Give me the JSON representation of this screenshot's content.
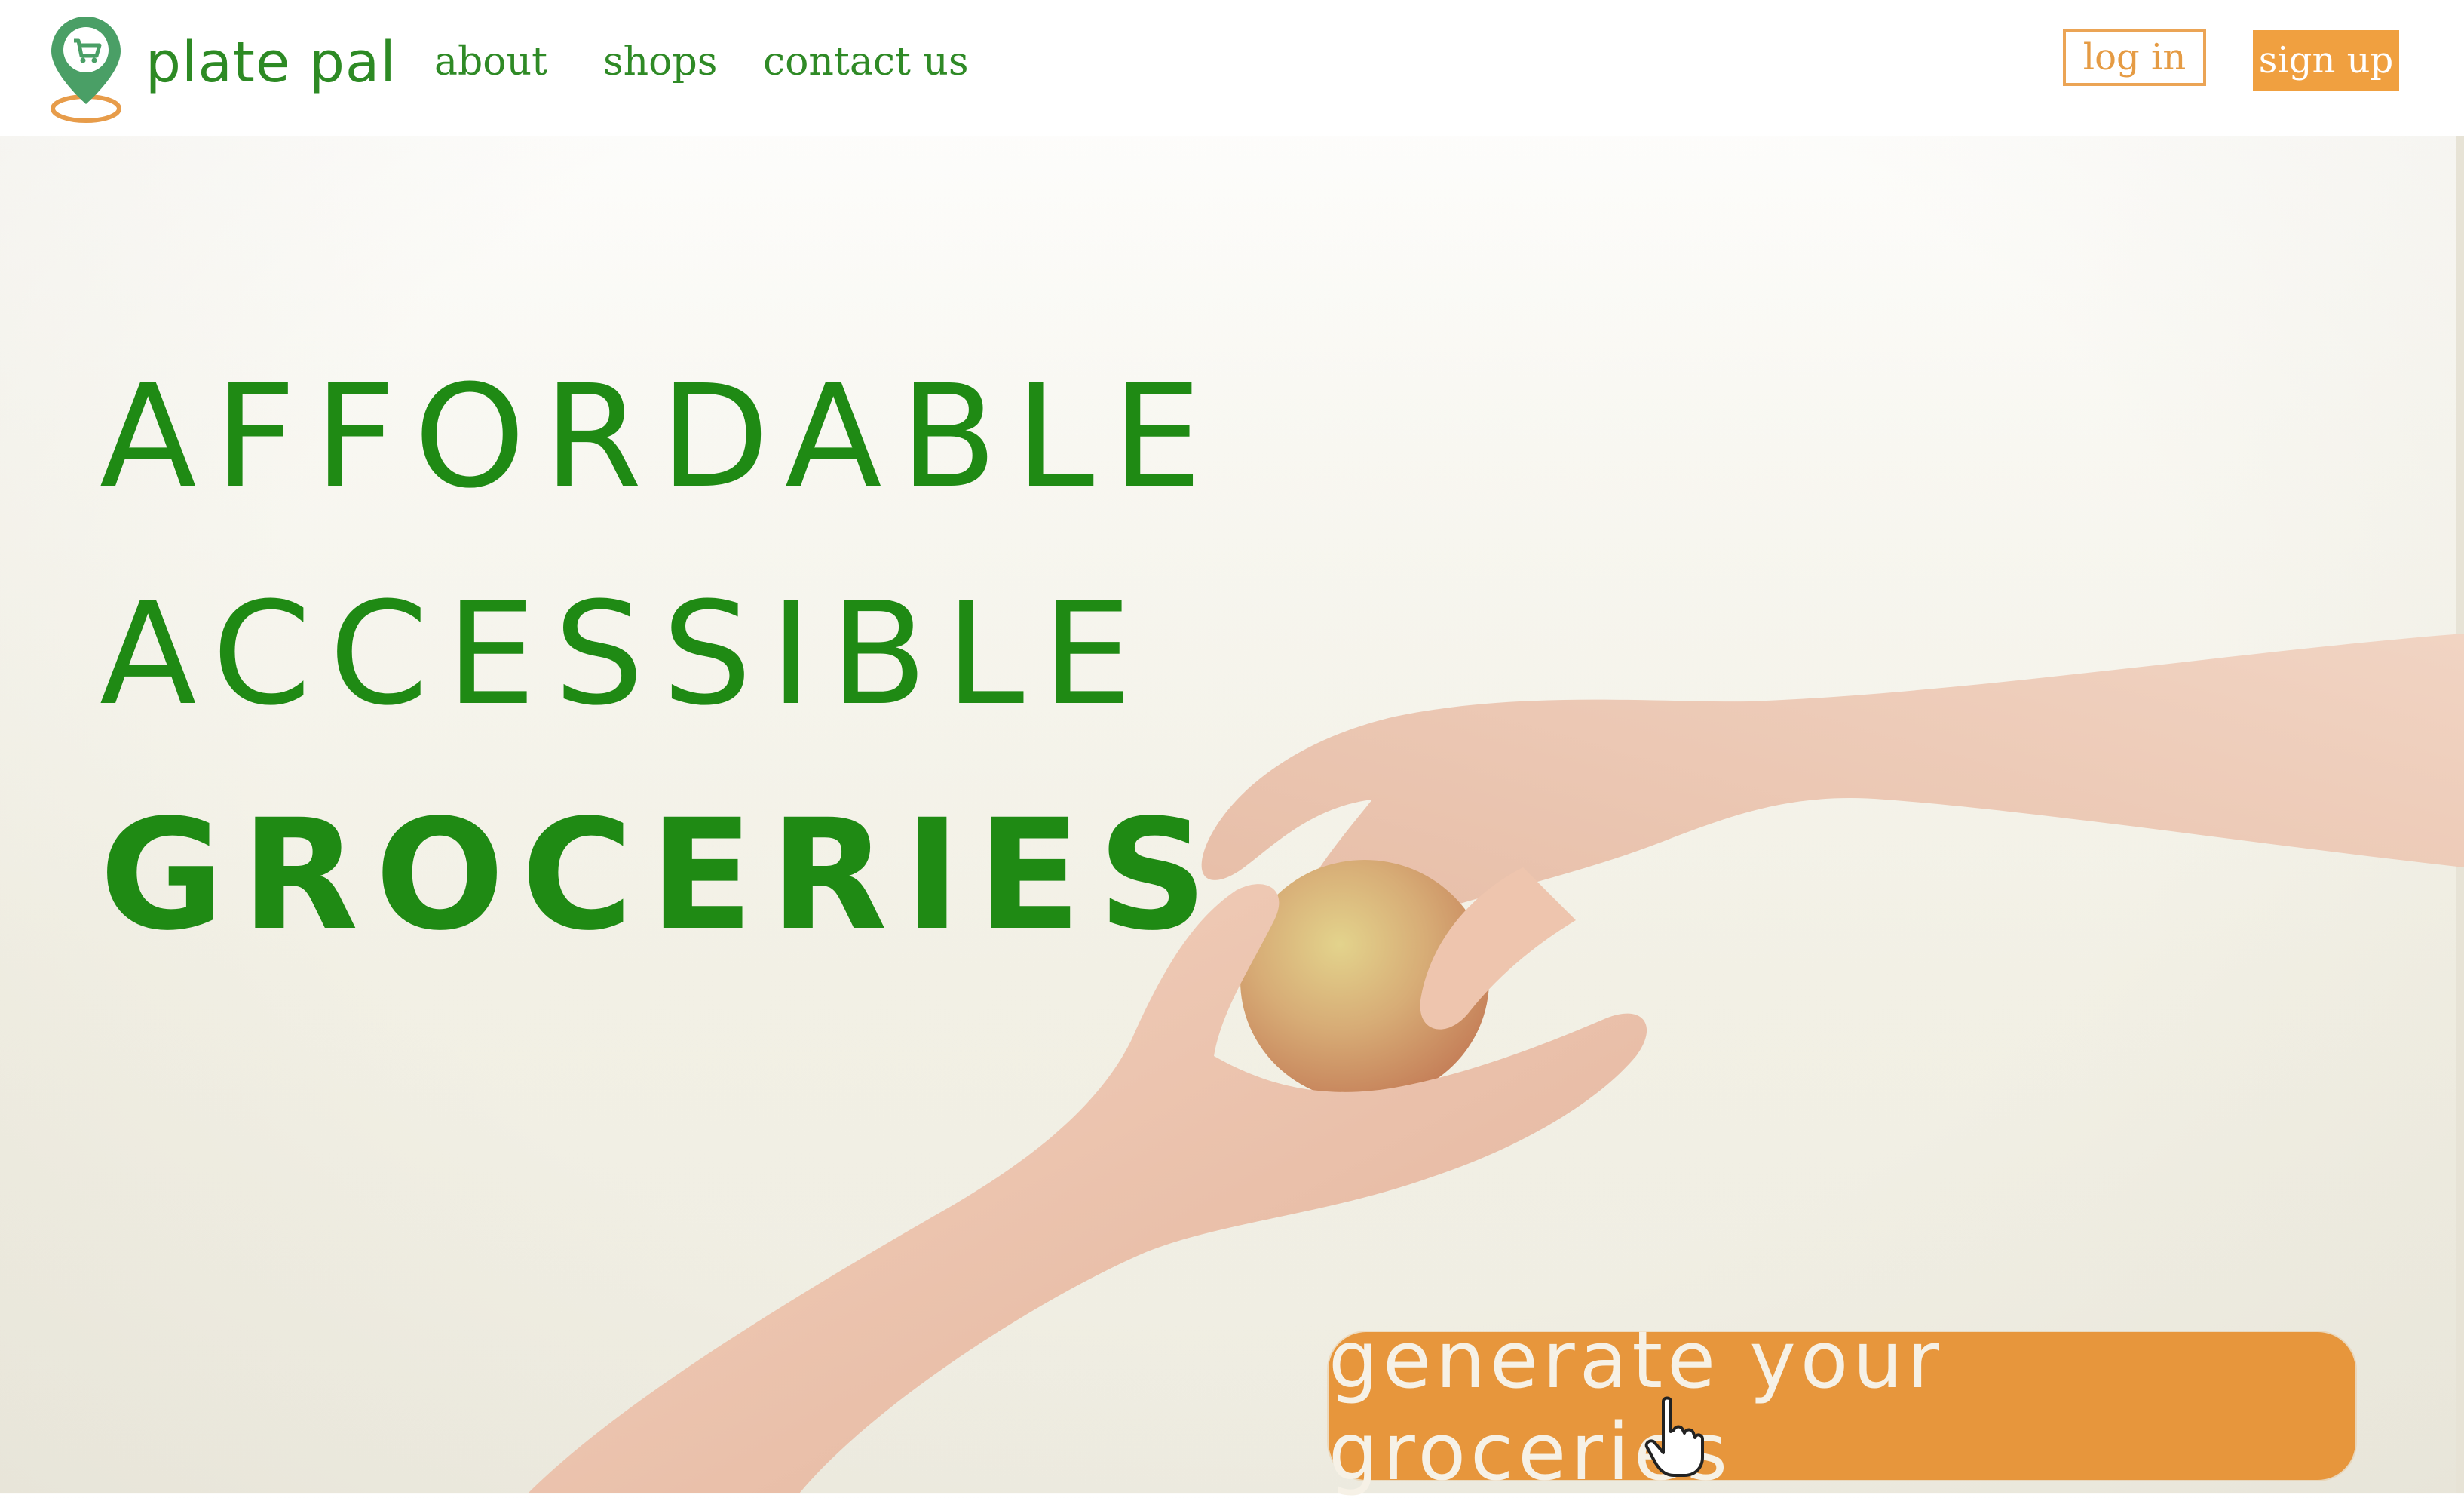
{
  "header": {
    "brand": "plate pal",
    "nav": [
      {
        "label": "about"
      },
      {
        "label": "shops"
      },
      {
        "label": "contact us"
      }
    ],
    "login_label": "log in",
    "signup_label": "sign up"
  },
  "hero": {
    "lines": [
      "AFFORDABLE",
      "ACCESSIBLE",
      "GROCERIES"
    ],
    "cta_label": "generate your groceries",
    "image_icon": "hands-sharing-apple"
  },
  "colors": {
    "brand_green": "#1f8a14",
    "nav_green": "#2f8a26",
    "accent_orange": "#e7963c",
    "signup_orange": "#f0a040"
  },
  "icons": {
    "logo": "map-pin-cart-icon",
    "cursor": "hand-pointer-icon"
  }
}
